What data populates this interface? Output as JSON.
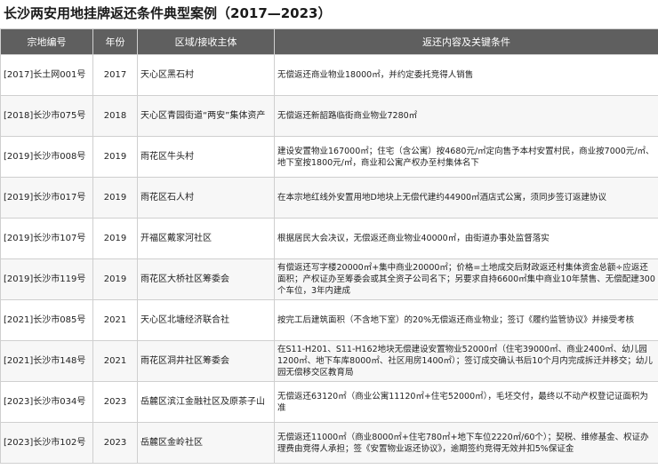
{
  "title": "长沙两安用地挂牌返还条件典型案例（2017—2023）",
  "headers": [
    "宗地编号",
    "年份",
    "区域/接收主体",
    "返还内容及关键条件"
  ],
  "rows": [
    {
      "id": "[2017]长土网001号",
      "year": "2017",
      "area": "天心区黑石村",
      "condition": "无偿返还商业物业18000㎡，并约定委托竞得人销售"
    },
    {
      "id": "[2018]长沙市075号",
      "year": "2018",
      "area": "天心区青园街道“两安”集体资产",
      "condition": "无偿返还新韶路临街商业物业7280㎡"
    },
    {
      "id": "[2019]长沙市008号",
      "year": "2019",
      "area": "雨花区牛头村",
      "condition": "建设安置物业167000㎡；住宅（含公寓）按4680元/㎡定向售予本村安置村民，商业按7000元/㎡、地下室按1800元/㎡，商业和公寓产权办至村集体名下"
    },
    {
      "id": "[2019]长沙市017号",
      "year": "2019",
      "area": "雨花区石人村",
      "condition": "在本宗地红线外安置用地D地块上无偿代建约44900㎡酒店式公寓，须同步签订返建协议"
    },
    {
      "id": "[2019]长沙市107号",
      "year": "2019",
      "area": "开福区戴家河社区",
      "condition": "根据居民大会决议，无偿返还商业物业40000㎡，由街道办事处监督落实"
    },
    {
      "id": "[2019]长沙市119号",
      "year": "2019",
      "area": "雨花区大桥社区筹委会",
      "condition": "有偿返还写字楼20000㎡+集中商业20000㎡；价格=土地成交后财政返还村集体资金总额÷应返还面积；产权证办至筹委会或其全资子公司名下；另要求自持6600㎡集中商业10年禁售、无偿配建300个车位，3年内建成"
    },
    {
      "id": "[2021]长沙市085号",
      "year": "2021",
      "area": "天心区北塘经济联合社",
      "condition": "按完工后建筑面积（不含地下室）的20%无偿返还商业物业；签订《履约监管协议》并接受考核"
    },
    {
      "id": "[2021]长沙市148号",
      "year": "2021",
      "area": "雨花区洞井社区筹委会",
      "condition": "在S11-H201、S11-H162地块无偿建设安置物业52000㎡（住宅39000㎡、商业2400㎡、幼儿园1200㎡、地下车库8000㎡、社区用房1400㎡）；签订成交确认书后10个月内完成拆迁并移交；幼儿园无偿移交区教育局"
    },
    {
      "id": "[2023]长沙市034号",
      "year": "2023",
      "area": "岳麓区滨江金融社区及原茶子山",
      "condition": "无偿返还63120㎡（商业公寓11120㎡+住宅52000㎡），毛坯交付，最终以不动产权登记证面积为准"
    },
    {
      "id": "[2023]长沙市102号",
      "year": "2023",
      "area": "岳麓区金岭社区",
      "condition": "无偿返还11000㎡（商业8000㎡+住宅780㎡+地下车位2220㎡/60个）；契税、维修基金、权证办理费由竞得人承担；签《安置物业返还协议》，逾期签约竞得无效并扣5%保证金"
    }
  ]
}
